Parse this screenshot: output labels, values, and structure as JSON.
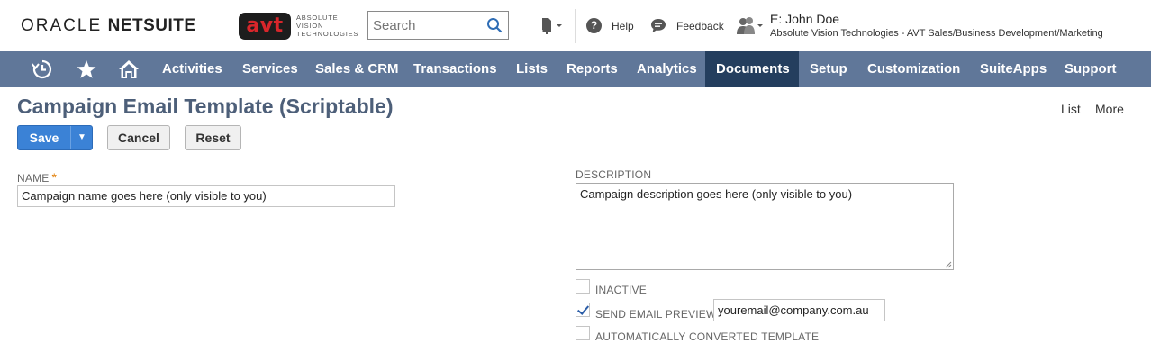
{
  "header": {
    "brand_oracle": "ORACLE",
    "brand_netsuite": "NETSUITE",
    "company_logo": "avt",
    "company_logo_text": [
      "ABSOLUTE",
      "VISION",
      "TECHNOLOGIES"
    ],
    "search_placeholder": "Search",
    "help_label": "Help",
    "feedback_label": "Feedback",
    "user_name": "E: John Doe",
    "user_role": "Absolute Vision Technologies - AVT Sales/Business Development/Marketing"
  },
  "nav": {
    "items": [
      {
        "label": "Activities"
      },
      {
        "label": "Services"
      },
      {
        "label": "Sales & CRM"
      },
      {
        "label": "Transactions"
      },
      {
        "label": "Lists"
      },
      {
        "label": "Reports"
      },
      {
        "label": "Analytics"
      },
      {
        "label": "Documents",
        "active": true
      },
      {
        "label": "Setup"
      },
      {
        "label": "Customization"
      },
      {
        "label": "SuiteApps"
      },
      {
        "label": "Support"
      }
    ],
    "icons": [
      "recent-records-icon",
      "favorites-star-icon",
      "home-icon"
    ]
  },
  "page": {
    "title": "Campaign Email Template (Scriptable)",
    "link_list": "List",
    "link_more": "More"
  },
  "buttons": {
    "save": "Save",
    "save_menu_caret": "▼",
    "cancel": "Cancel",
    "reset": "Reset"
  },
  "form": {
    "name_label": "NAME",
    "name_required_marker": "*",
    "name_value": "Campaign name goes here (only visible to you)",
    "description_label": "DESCRIPTION",
    "description_value": "Campaign description goes here (only visible to you)",
    "inactive_label": "INACTIVE",
    "inactive_checked": false,
    "send_preview_label": "SEND EMAIL PREVIEW",
    "send_preview_checked": true,
    "preview_email_value": "youremail@company.com.au",
    "auto_converted_label": "AUTOMATICALLY CONVERTED TEMPLATE",
    "auto_converted_checked": false
  },
  "colors": {
    "navbar": "#607799",
    "navbar_active": "#243e5e",
    "title": "#4d5f79",
    "save_button": "#3b82d6",
    "required_star": "#e07b00"
  }
}
